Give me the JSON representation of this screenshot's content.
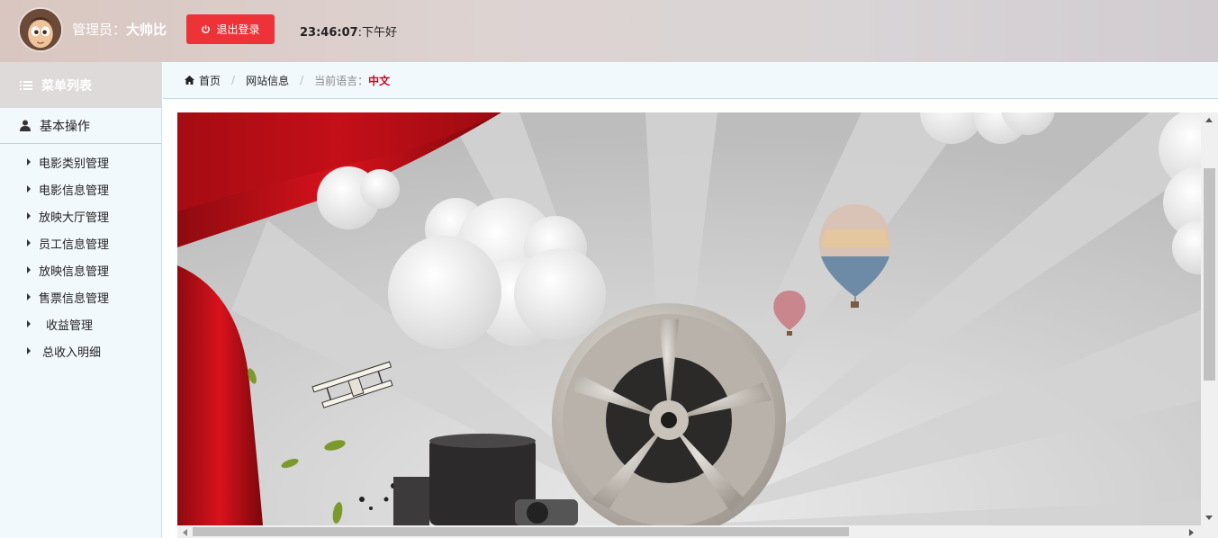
{
  "header": {
    "admin_prefix": "管理员：",
    "admin_name": "大帅比",
    "logout_label": "退出登录",
    "time": "23:46:07",
    "greeting": ":下午好"
  },
  "sidebar": {
    "menu_title": "菜单列表",
    "section_title": "基本操作",
    "items": [
      {
        "label": "电影类别管理"
      },
      {
        "label": "电影信息管理"
      },
      {
        "label": "放映大厅管理"
      },
      {
        "label": "员工信息管理"
      },
      {
        "label": "放映信息管理"
      },
      {
        "label": "售票信息管理"
      },
      {
        "label": "收益管理"
      },
      {
        "label": "总收入明细"
      }
    ]
  },
  "breadcrumb": {
    "home": "首页",
    "page": "网站信息",
    "lang_label": "当前语言：",
    "lang_value": "中文"
  },
  "colors": {
    "logout_button": "#ee3338",
    "language_value": "#d0021b",
    "sidebar_bg": "#f2f9fd"
  },
  "icons": {
    "logout": "power-icon",
    "menu": "list-icon",
    "section": "user-icon",
    "breadcrumb_home": "home-icon"
  }
}
